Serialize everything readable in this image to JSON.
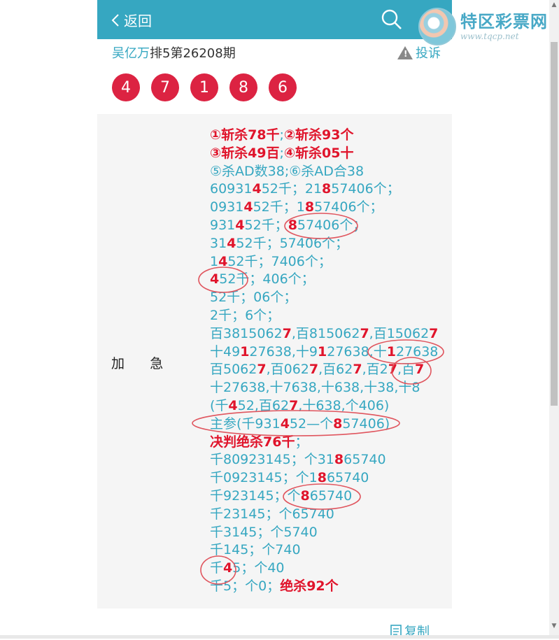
{
  "header": {
    "back_label": "返回",
    "logo_title": "特区彩票网",
    "logo_url": "www.tqcp.net"
  },
  "title": {
    "author": "吴亿万",
    "text": "排5第26208期",
    "complaint": "投诉"
  },
  "balls": [
    "4",
    "7",
    "1",
    "8",
    "6"
  ],
  "section_label_a": "加",
  "section_label_b": "急",
  "lines": [
    [
      [
        "①斩杀78千",
        1
      ],
      [
        ";",
        0
      ],
      [
        "②斩杀93个",
        1
      ]
    ],
    [
      [
        "③斩杀49百",
        1
      ],
      [
        ";",
        0
      ],
      [
        "④斩杀05十",
        1
      ]
    ],
    [
      [
        "⑤杀AD数38;⑥杀AD合38",
        0
      ]
    ],
    [
      [
        "60931",
        0
      ],
      [
        "4",
        1
      ],
      [
        "52千；21",
        0
      ],
      [
        "8",
        1
      ],
      [
        "57406个；",
        0
      ]
    ],
    [
      [
        "0931",
        0
      ],
      [
        "4",
        1
      ],
      [
        "52千；1",
        0
      ],
      [
        "8",
        1
      ],
      [
        "57406个；",
        0
      ]
    ],
    [
      [
        "931",
        0
      ],
      [
        "4",
        1
      ],
      [
        "52千；",
        0
      ],
      [
        "8",
        1
      ],
      [
        "57406个；",
        0
      ]
    ],
    [
      [
        "31",
        0
      ],
      [
        "4",
        1
      ],
      [
        "52千；57406个；",
        0
      ]
    ],
    [
      [
        "1",
        0
      ],
      [
        "4",
        1
      ],
      [
        "52千；7406个；",
        0
      ]
    ],
    [
      [
        "4",
        1
      ],
      [
        "52千；406个；",
        0
      ]
    ],
    [
      [
        "52千；06个；",
        0
      ]
    ],
    [
      [
        "2千；6个；",
        0
      ]
    ],
    [
      [
        "百3815062",
        0
      ],
      [
        "7",
        1
      ],
      [
        ",百815062",
        0
      ],
      [
        "7",
        1
      ],
      [
        ",百15062",
        0
      ],
      [
        "7",
        1
      ]
    ],
    [
      [
        "十49",
        0
      ],
      [
        "1",
        1
      ],
      [
        "27638,十9",
        0
      ],
      [
        "1",
        1
      ],
      [
        "27638,十",
        0
      ],
      [
        "1",
        1
      ],
      [
        "27638",
        0
      ]
    ],
    [
      [
        "百5062",
        0
      ],
      [
        "7",
        1
      ],
      [
        ",百062",
        0
      ],
      [
        "7",
        1
      ],
      [
        ",百62",
        0
      ],
      [
        "7",
        1
      ],
      [
        ",百2",
        0
      ],
      [
        "7",
        1
      ],
      [
        ",百",
        0
      ],
      [
        "7",
        1
      ]
    ],
    [
      [
        "十27638,十7638,十638,十38,十8",
        0
      ]
    ],
    [
      [
        "(千",
        0
      ],
      [
        "4",
        1
      ],
      [
        "52,百62",
        0
      ],
      [
        "7",
        1
      ],
      [
        ",十638,个406)",
        0
      ]
    ],
    [
      [
        "主参(千931",
        0
      ],
      [
        "4",
        1
      ],
      [
        "52—个",
        0
      ],
      [
        "8",
        1
      ],
      [
        "57406)",
        0
      ]
    ],
    [
      [
        "决判绝杀76千",
        1
      ],
      [
        "；",
        0
      ]
    ],
    [
      [
        "千8092314",
        0
      ],
      [
        "5",
        0
      ],
      [
        "；个31",
        0
      ],
      [
        "8",
        1
      ],
      [
        "65740",
        0
      ]
    ],
    [
      [
        "千092314",
        0
      ],
      [
        "5；个1",
        0
      ],
      [
        "8",
        1
      ],
      [
        "65740",
        0
      ]
    ],
    [
      [
        "千92314",
        0
      ],
      [
        "5；个",
        0
      ],
      [
        "8",
        1
      ],
      [
        "65740",
        0
      ]
    ],
    [
      [
        "千2314",
        0
      ],
      [
        "5；个65740",
        0
      ]
    ],
    [
      [
        "千314",
        0
      ],
      [
        "5；个5740",
        0
      ]
    ],
    [
      [
        "千14",
        0
      ],
      [
        "5；个740",
        0
      ]
    ],
    [
      [
        "千",
        0
      ],
      [
        "4",
        1
      ],
      [
        "5；个40",
        0
      ]
    ],
    [
      [
        "千5；个0；",
        0
      ],
      [
        "绝杀92个",
        1
      ]
    ]
  ],
  "copy_label": "复制"
}
